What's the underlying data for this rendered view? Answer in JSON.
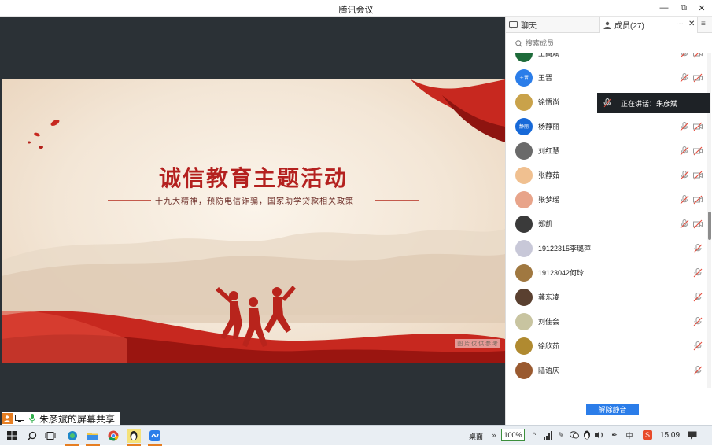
{
  "window": {
    "title": "腾讯会议",
    "minimize_glyph": "—",
    "restore_glyph": "⧉",
    "close_glyph": "✕"
  },
  "slide": {
    "title": "诚信教育主题活动",
    "subtitle": "十九大精神，预防电信诈骗，国家助学贷款相关政策",
    "credit": "图 片 仅 供 参 考"
  },
  "share_label": "朱彦斌的屏幕共享",
  "panel": {
    "tab_chat": "聊天",
    "tab_members": "成员(27)",
    "more_glyph": "···",
    "close_glyph": "✕",
    "menu_glyph": "≡",
    "search_placeholder": "搜索成员",
    "unmute_all": "解除静音"
  },
  "speaking_tip": "正在讲话：朱彦斌",
  "members": [
    {
      "name": "王高斌",
      "avatar_color": "#1e6b3a",
      "avatar_text": "",
      "video_off": true
    },
    {
      "name": "王晋",
      "avatar_color": "#2b7de9",
      "avatar_text": "王晋",
      "video_off": true
    },
    {
      "name": "徐悟尚",
      "avatar_color": "#c9a24a",
      "avatar_text": "",
      "video_off": true
    },
    {
      "name": "杨静丽",
      "avatar_color": "#1769d8",
      "avatar_text": "静丽",
      "video_off": true
    },
    {
      "name": "刘红慧",
      "avatar_color": "#6a6a6a",
      "avatar_text": "",
      "video_off": true
    },
    {
      "name": "张静茹",
      "avatar_color": "#f0c090",
      "avatar_text": "",
      "video_off": true
    },
    {
      "name": "张梦瑶",
      "avatar_color": "#e8a48a",
      "avatar_text": "",
      "video_off": true
    },
    {
      "name": "郑凯",
      "avatar_color": "#3a3a3a",
      "avatar_text": "",
      "video_off": true
    },
    {
      "name": "19122315李璐萍",
      "avatar_color": "#c8c8d8",
      "avatar_text": "",
      "video_off": false
    },
    {
      "name": "19123042何玲",
      "avatar_color": "#a07840",
      "avatar_text": "",
      "video_off": false
    },
    {
      "name": "龚东凌",
      "avatar_color": "#5a4030",
      "avatar_text": "",
      "video_off": false
    },
    {
      "name": "刘佳会",
      "avatar_color": "#c8c4a0",
      "avatar_text": "",
      "video_off": false
    },
    {
      "name": "徐欣茹",
      "avatar_color": "#b08a30",
      "avatar_text": "",
      "video_off": false
    },
    {
      "name": "陆语庆",
      "avatar_color": "#9a5a30",
      "avatar_text": "",
      "video_off": false
    }
  ],
  "taskbar": {
    "desktop_label": "桌面",
    "battery": "100%",
    "clock": "15:09"
  },
  "colors": {
    "accent": "#2b7de9",
    "slide_red": "#b4211f",
    "main_bg": "#2b3136"
  }
}
